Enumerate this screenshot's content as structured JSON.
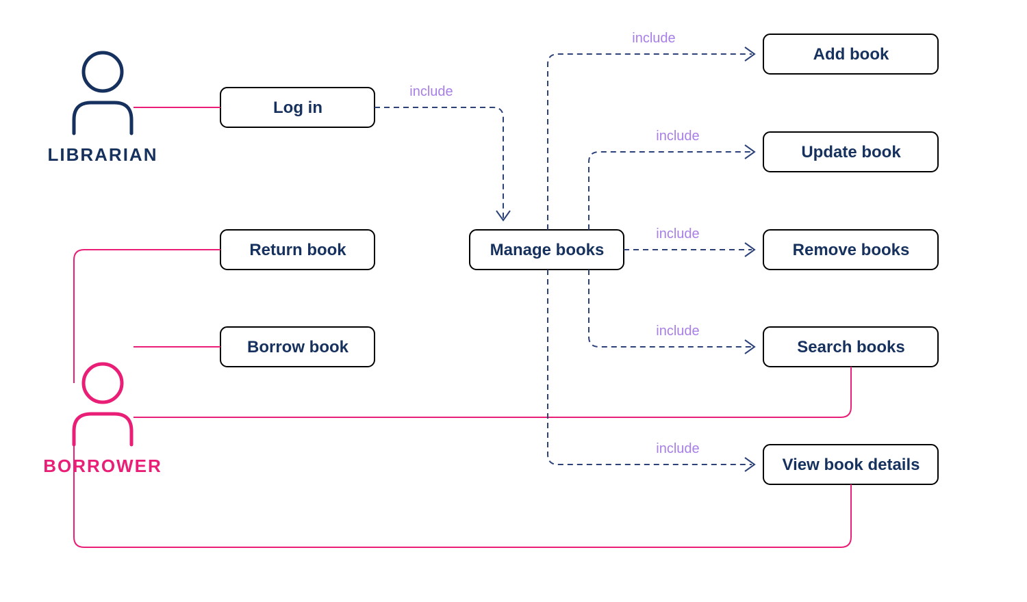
{
  "actors": {
    "librarian": "LIBRARIAN",
    "borrower": "BORROWER"
  },
  "nodes": {
    "login": "Log in",
    "return_book": "Return book",
    "borrow_book": "Borrow book",
    "manage_books": "Manage books",
    "add_book": "Add book",
    "update_book": "Update book",
    "remove_books": "Remove books",
    "search_books": "Search books",
    "view_book_details": "View book details"
  },
  "edge_label": "include"
}
